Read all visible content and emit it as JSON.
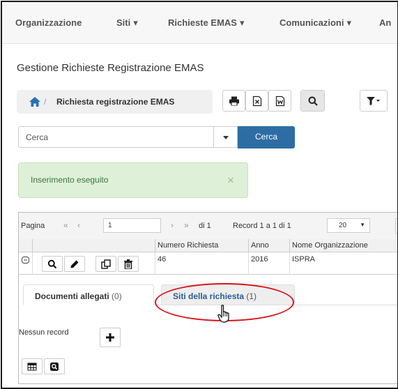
{
  "navbar": {
    "items": [
      {
        "label": "Organizzazione",
        "caret": ""
      },
      {
        "label": "Siti",
        "caret": "▾"
      },
      {
        "label": "Richieste EMAS",
        "caret": "▾"
      },
      {
        "label": "Comunicazioni",
        "caret": "▾"
      },
      {
        "label": "An",
        "caret": ""
      }
    ]
  },
  "page": {
    "title": "Gestione Richieste Registrazione EMAS"
  },
  "breadcrumb": {
    "separator": "/",
    "label": "Richiesta registrazione EMAS"
  },
  "search": {
    "placeholder": "Cerca",
    "button_label": "Cerca"
  },
  "alert": {
    "message": "Inserimento eseguito",
    "close": "×"
  },
  "grid": {
    "pager": {
      "page_label": "Pagina",
      "page_value": "1",
      "of_label": "di 1",
      "record_label": "Record 1 a 1 di 1",
      "page_size": "20"
    },
    "columns": [
      "Numero Richiesta",
      "Anno",
      "Nome Organizzazione"
    ],
    "rows": [
      {
        "numero": "46",
        "anno": "2016",
        "nome": "ISPRA"
      }
    ]
  },
  "tabs": [
    {
      "label": "Documenti allegati",
      "count": "(0)",
      "active": true
    },
    {
      "label": "Siti della richiesta",
      "count": "(1)",
      "active": false
    }
  ],
  "subgrid": {
    "empty_text": "Nessun record"
  },
  "colors": {
    "primary": "#2e6da4",
    "alert_bg": "#dff0d8",
    "alert_text": "#3c763d",
    "link": "#2a5d93",
    "highlight": "#d9161e"
  }
}
